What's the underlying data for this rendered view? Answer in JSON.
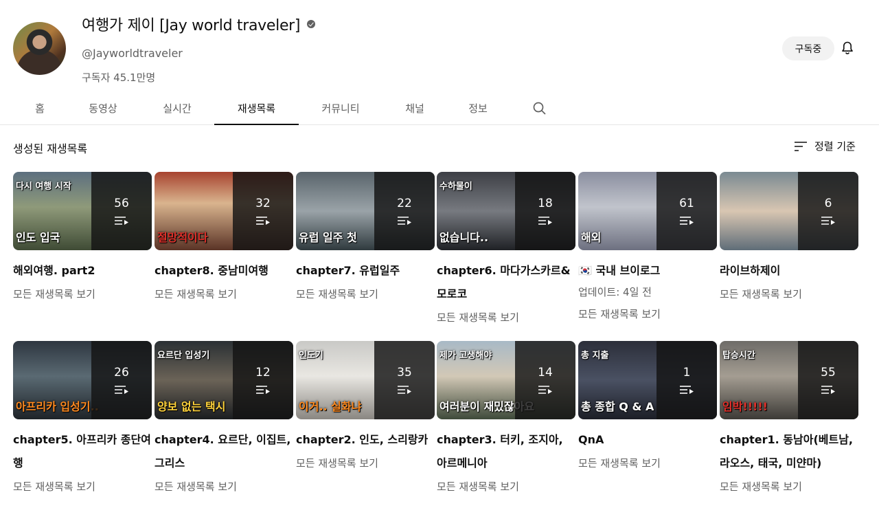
{
  "channel": {
    "name": "여행가 제이 [Jay world traveler]",
    "handle": "@Jayworldtraveler",
    "subscribers": "구독자 45.1만명",
    "subscribe_label": "구독중"
  },
  "tabs": [
    "홈",
    "동영상",
    "실시간",
    "재생목록",
    "커뮤니티",
    "채널",
    "정보"
  ],
  "active_tab": "재생목록",
  "section": {
    "title": "생성된 재생목록",
    "sort_label": "정렬 기준"
  },
  "playlists": [
    {
      "title": "해외여행. part2",
      "count": "56",
      "link": "모든 재생목록 보기",
      "meta": "",
      "caption": "인도 입국",
      "caption_top": "다시 여행 시작"
    },
    {
      "title": "chapter8. 중남미여행",
      "count": "32",
      "link": "모든 재생목록 보기",
      "meta": "",
      "caption": "절망적이다",
      "caption_top": ""
    },
    {
      "title": "chapter7. 유럽일주",
      "count": "22",
      "link": "모든 재생목록 보기",
      "meta": "",
      "caption": "유럽 일주 첫",
      "caption_top": ""
    },
    {
      "title": "chapter6. 마다가스카르&모로코",
      "count": "18",
      "link": "모든 재생목록 보기",
      "meta": "",
      "caption": "없습니다..",
      "caption_top": "수하물이"
    },
    {
      "title": "🇰🇷 국내 브이로그",
      "count": "61",
      "link": "모든 재생목록 보기",
      "meta": "업데이트: 4일 전",
      "caption": "해외",
      "caption_top": ""
    },
    {
      "title": "라이브하제이",
      "count": "6",
      "link": "모든 재생목록 보기",
      "meta": "",
      "caption": "",
      "caption_top": ""
    },
    {
      "title": "chapter5. 아프리카 종단여행",
      "count": "26",
      "link": "모든 재생목록 보기",
      "meta": "",
      "caption": "아프리카 입성기..",
      "caption_top": ""
    },
    {
      "title": "chapter4. 요르단, 이집트, 그리스",
      "count": "12",
      "link": "모든 재생목록 보기",
      "meta": "",
      "caption": "양보 없는 택시",
      "caption_top": "요르단 입성기"
    },
    {
      "title": "chapter2. 인도, 스리랑카",
      "count": "35",
      "link": "모든 재생목록 보기",
      "meta": "",
      "caption": "이거.. 실화냐",
      "caption_top": "인도기"
    },
    {
      "title": "chapter3. 터키, 조지아, 아르메니아",
      "count": "14",
      "link": "모든 재생목록 보기",
      "meta": "",
      "caption": "여러분이 재밌잖아요",
      "caption_top": "제가 고생해야"
    },
    {
      "title": "QnA",
      "count": "1",
      "link": "모든 재생목록 보기",
      "meta": "",
      "caption": "총 종합 Q & A",
      "caption_top": "총 지출"
    },
    {
      "title": "chapter1. 동남아(베트남, 라오스, 태국, 미얀마)",
      "count": "55",
      "link": "모든 재생목록 보기",
      "meta": "",
      "caption": "임박!!!!!",
      "caption_top": "탑승시간"
    }
  ],
  "colors": {
    "text_primary": "#0f0f0f",
    "text_secondary": "#606060",
    "caption_orange": "#ff8a1f",
    "caption_red": "#e0302a"
  }
}
